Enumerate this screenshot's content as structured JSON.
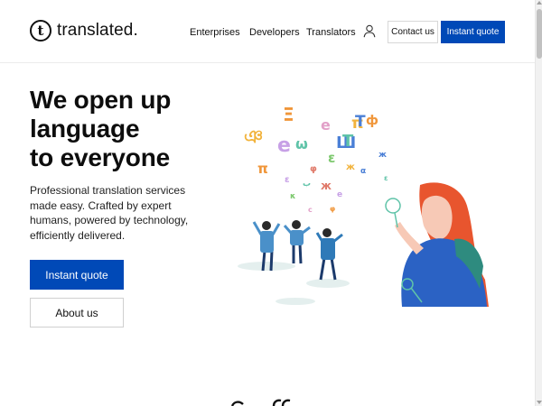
{
  "brand": {
    "logo_glyph": "t",
    "name": "translated."
  },
  "nav": {
    "items": [
      {
        "label": "Enterprises"
      },
      {
        "label": "Developers"
      },
      {
        "label": "Translators"
      }
    ],
    "user_icon": "user-icon",
    "contact_label": "Contact us",
    "quote_label": "Instant quote"
  },
  "hero": {
    "title_lines": [
      "We open up",
      "language",
      "to everyone"
    ],
    "description": "Professional translation services made easy. Crafted by expert humans, powered by technology, efficiently delivered.",
    "primary_button": "Instant quote",
    "secondary_button": "About us"
  },
  "colors": {
    "primary_blue": "#0049b7",
    "text_dark": "#111111",
    "hair_orange": "#e8552e"
  }
}
